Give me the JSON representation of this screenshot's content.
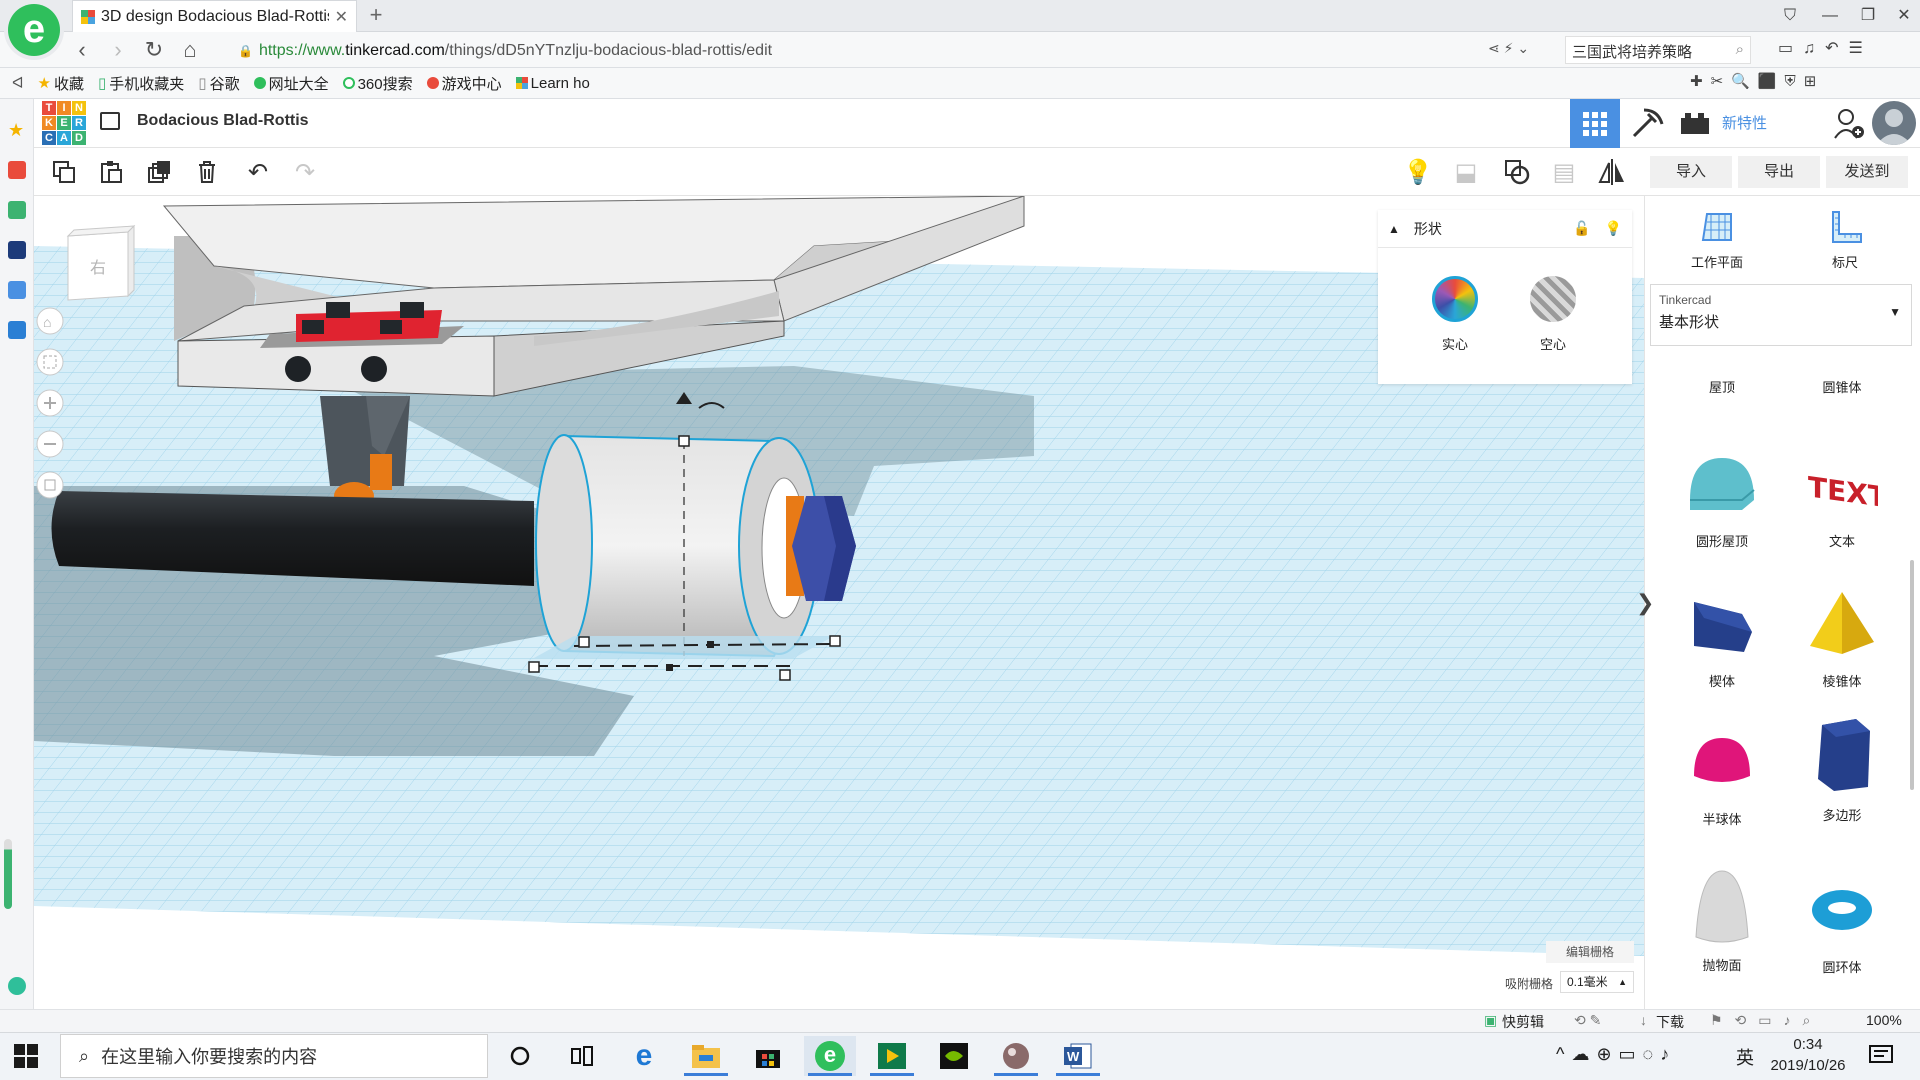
{
  "browser": {
    "tab_title": "3D design Bodacious Blad-Rottis",
    "url_prefix": "https://www.",
    "url_domain": "tinkercad.com",
    "url_path": "/things/dD5nYTnzlju-bodacious-blad-rottis/edit",
    "search_text": "三国武将培养策略",
    "bookmarks": [
      "收藏",
      "手机收藏夹",
      "谷歌",
      "网址大全",
      "360搜索",
      "游戏中心",
      "Learn ho"
    ]
  },
  "tinkercad": {
    "logo_letters": [
      "T",
      "I",
      "N",
      "K",
      "E",
      "R",
      "C",
      "A",
      "D"
    ],
    "design_title": "Bodacious Blad-Rottis",
    "new_features": "新特性",
    "import": "导入",
    "export": "导出",
    "send_to": "发送到",
    "view_cube_label": "右",
    "props": {
      "title": "形状",
      "solid": "实心",
      "hole": "空心"
    },
    "workplane": "工作平面",
    "ruler": "标尺",
    "library_source": "Tinkercad",
    "library_name": "基本形状",
    "shapes": [
      "屋顶",
      "圆锥体",
      "圆形屋顶",
      "文本",
      "楔体",
      "棱锥体",
      "半球体",
      "多边形",
      "抛物面",
      "圆环体"
    ],
    "edit_grid": "编辑栅格",
    "snap_label": "吸附栅格",
    "snap_value": "0.1毫米"
  },
  "statusbar": {
    "quick_clip": "快剪辑",
    "download": "下载",
    "zoom": "100%"
  },
  "taskbar": {
    "search_placeholder": "在这里输入你要搜索的内容",
    "ime": "英",
    "time": "0:34",
    "date": "2019/10/26"
  },
  "colors": {
    "tinkercad_blue": "#4a90e2",
    "selection_outline": "#1fa3d6",
    "grid_line": "#9fd3ea",
    "nut": "#3d4fa8",
    "axle": "#1f2326",
    "red_part": "#e02330",
    "orange": "#e87a16"
  }
}
